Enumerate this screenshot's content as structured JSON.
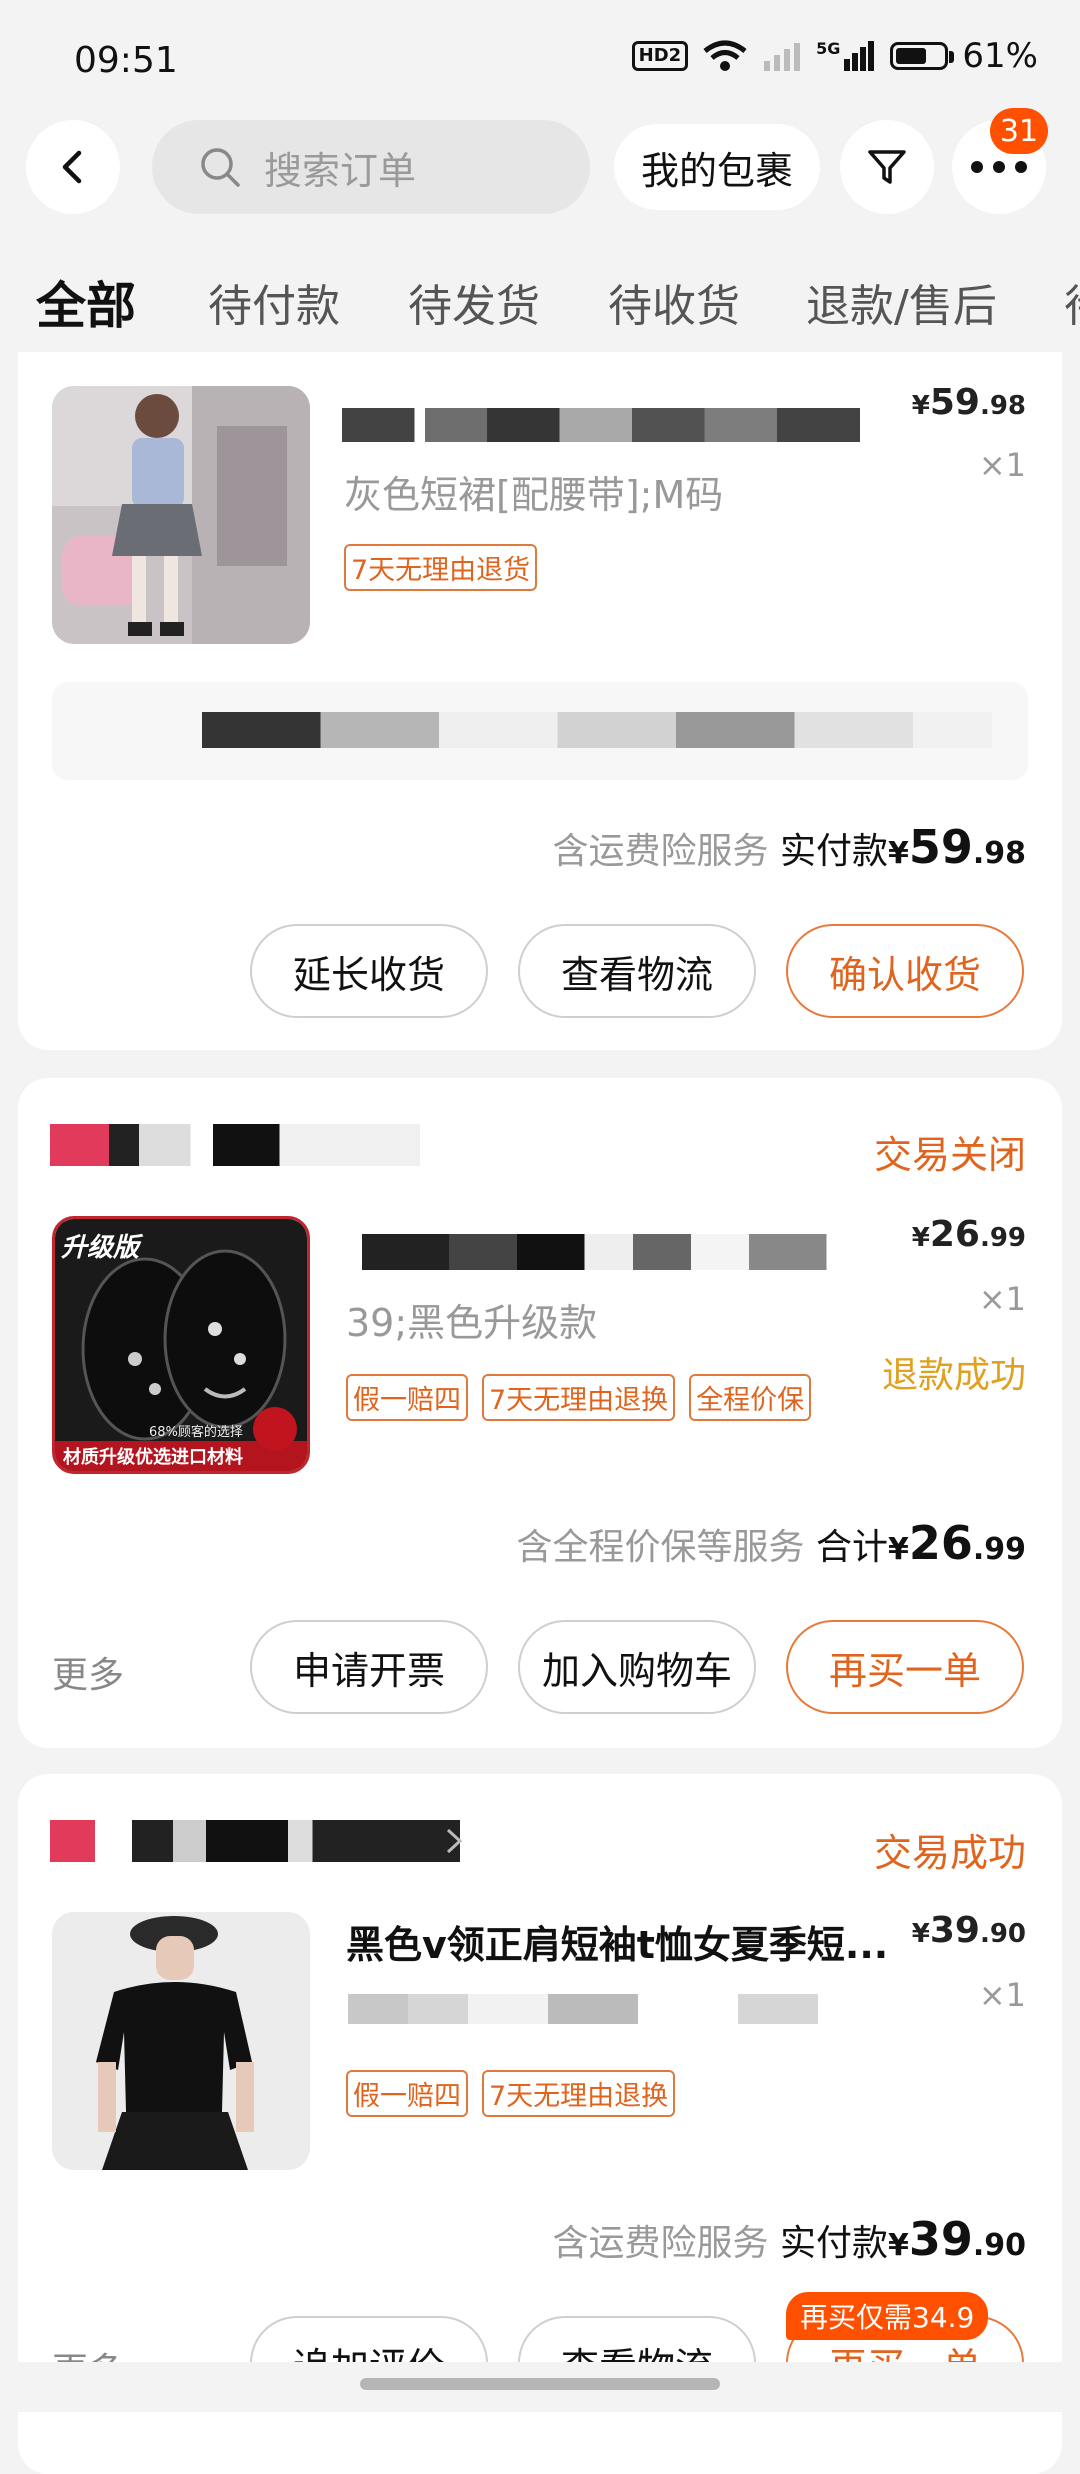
{
  "status_bar": {
    "time": "09:51",
    "battery": "61%",
    "hd_label": "HD2",
    "signal_label": "5G"
  },
  "header": {
    "search_placeholder": "搜索订单",
    "my_packages_label": "我的包裹",
    "message_badge_count": "31"
  },
  "tabs": [
    {
      "label": "全部",
      "active": true
    },
    {
      "label": "待付款"
    },
    {
      "label": "待发货"
    },
    {
      "label": "待收货"
    },
    {
      "label": "退款/售后"
    },
    {
      "label": "待"
    }
  ],
  "orders": [
    {
      "product_sku": "灰色短裙[配腰带];M码",
      "price_int": "59",
      "price_dec": ".98",
      "yen": "¥",
      "quantity": "×1",
      "tags": [
        "7天无理由退货"
      ],
      "total_prefix": "含运费险服务",
      "total_label": "实付款",
      "total_int": "59",
      "total_dec": ".98",
      "buttons": [
        "延长收货",
        "查看物流",
        "确认收货"
      ]
    },
    {
      "status": "交易关闭",
      "product_sku": "39;黑色升级款",
      "image_text_top": "升级版",
      "image_text_mid": "68%顾客的选择",
      "image_text_bottom": "材质升级优选进口材料",
      "price_int": "26",
      "price_dec": ".99",
      "yen": "¥",
      "quantity": "×1",
      "refund_status": "退款成功",
      "tags": [
        "假一赔四",
        "7天无理由退换",
        "全程价保"
      ],
      "total_prefix": "含全程价保等服务",
      "total_label": "合计",
      "total_int": "26",
      "total_dec": ".99",
      "more_label": "更多",
      "buttons": [
        "申请开票",
        "加入购物车",
        "再买一单"
      ]
    },
    {
      "status": "交易成功",
      "product_title": "黑色v领正肩短袖t恤女夏季短...",
      "price_int": "39",
      "price_dec": ".90",
      "yen": "¥",
      "quantity": "×1",
      "tags": [
        "假一赔四",
        "7天无理由退换"
      ],
      "total_prefix": "含运费险服务",
      "total_label": "实付款",
      "total_int": "39",
      "total_dec": ".90",
      "more_label": "更多",
      "rebuy_tip": "再买仅需34.9",
      "buttons": [
        "追加评价",
        "查看物流",
        "再买一单"
      ]
    }
  ],
  "colors": {
    "accent": "#ff5000",
    "tag_orange": "#e0641e",
    "refund_gold": "#e0a020",
    "background": "#f3f3f3"
  }
}
